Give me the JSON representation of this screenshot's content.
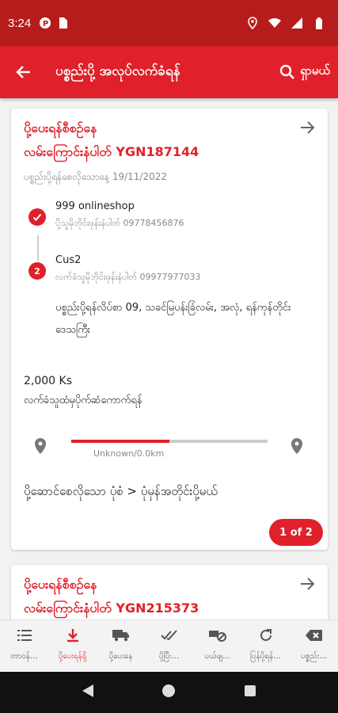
{
  "status_bar": {
    "time": "3:24"
  },
  "app_bar": {
    "title": "ပစ္စည်းပို့ အလုပ်လက်ခံရန်",
    "search_label": "ရှာမယ်"
  },
  "cards": [
    {
      "status": "ပို့ပေးရန်စီစဉ်နေ",
      "tracking": "လမ်းကြောင်းနံပါတ် YGN187144",
      "date_line": "ပစ္စည်းပို့ရန်စေလိုသောနေ့ 19/11/2022",
      "sender": {
        "step": "✓",
        "name": "999 onlineshop",
        "phone": "ပို့သူမိုဘိုင်းဖုန်းနံပါတ် 09778456876"
      },
      "receiver": {
        "step": "2",
        "name": "Cus2",
        "phone": "လက်ခံသူမိုဘိုင်းဖုန်းနံပါတ် 09977977033"
      },
      "address": "ပစ္စည်းပို့ရန်လိပ်စာ 09, သခင်မြပန်းခြံလမ်း, အလုံ, ရန်ကုန်တိုင်းဒေသကြီး",
      "amount": "2,000 Ks",
      "payment_type": "လက်ခံသူထံမှပိုက်ဆံကောက်ရန်",
      "distance": "Unknown/0.0km",
      "progress": 0.5,
      "pickup": "ပို့ဆောင်စေလိုသော ပုံစံ > ပုံမှန်အတိုင်းပို့မယ်",
      "page_badge": "1 of 2"
    },
    {
      "status": "ပို့ပေးရန်စီစဉ်နေ",
      "tracking": "လမ်းကြောင်းနံပါတ် YGN215373"
    }
  ],
  "bottom_nav": [
    {
      "label": "တာဝန်...",
      "icon": "list-icon"
    },
    {
      "label": "ပို့ပေးရန်ရှိ",
      "icon": "download-icon"
    },
    {
      "label": "ပို့ပေးနေ",
      "icon": "truck-icon"
    },
    {
      "label": "ပို့ပြီး...",
      "icon": "double-check-icon"
    },
    {
      "label": "ပယ်ဖျ...",
      "icon": "cancel-truck-icon"
    },
    {
      "label": "ပြန်ပို့ရန်...",
      "icon": "refresh-icon"
    },
    {
      "label": "ပစ္စည်း...",
      "icon": "backspace-icon"
    }
  ],
  "colors": {
    "primary": "#e0202a",
    "status_bar": "#b71c1c"
  }
}
